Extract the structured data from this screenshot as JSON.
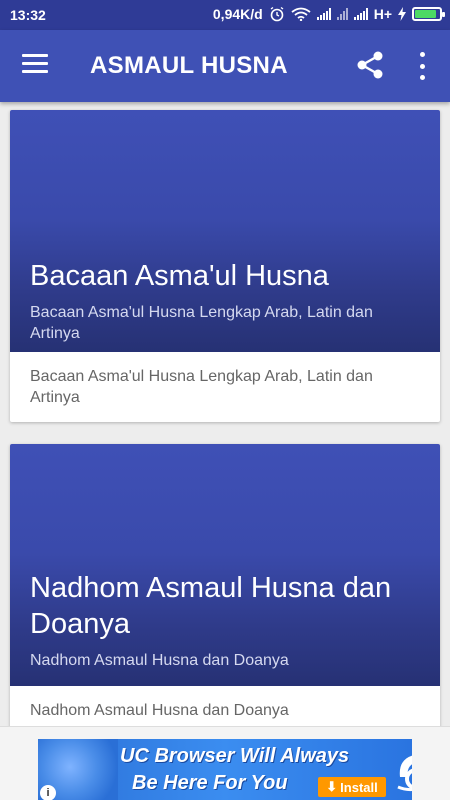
{
  "status_bar": {
    "time": "13:32",
    "net_speed": "0,94K/d",
    "network_type": "H+",
    "icons": [
      "alarm-icon",
      "wifi-icon",
      "signal-icon",
      "signal-icon",
      "signal-icon",
      "charging-icon",
      "battery-icon"
    ],
    "battery_level": 0.9
  },
  "app_bar": {
    "title": "ASMAUL HUSNA",
    "menu_icon": "menu-icon",
    "share_icon": "share-icon",
    "overflow_icon": "more-vert-icon"
  },
  "cards": [
    {
      "title": "Bacaan Asma'ul Husna",
      "subtitle": "Bacaan Asma'ul Husna Lengkap Arab, Latin dan Artinya",
      "description": "Bacaan Asma'ul Husna Lengkap Arab, Latin dan Artinya"
    },
    {
      "title": "Nadhom Asmaul Husna dan Doanya",
      "subtitle": "Nadhom Asmaul Husna dan Doanya",
      "description": "Nadhom Asmaul Husna dan Doanya"
    }
  ],
  "ad": {
    "line1": "UC Browser Will Always",
    "line2": "Be Here For You",
    "install_label": "Install",
    "info_label": "i"
  },
  "colors": {
    "primary": "#3f51b5",
    "primary_dark": "#2f3b96",
    "background": "#ededed",
    "ad_install": "#ff9800"
  }
}
